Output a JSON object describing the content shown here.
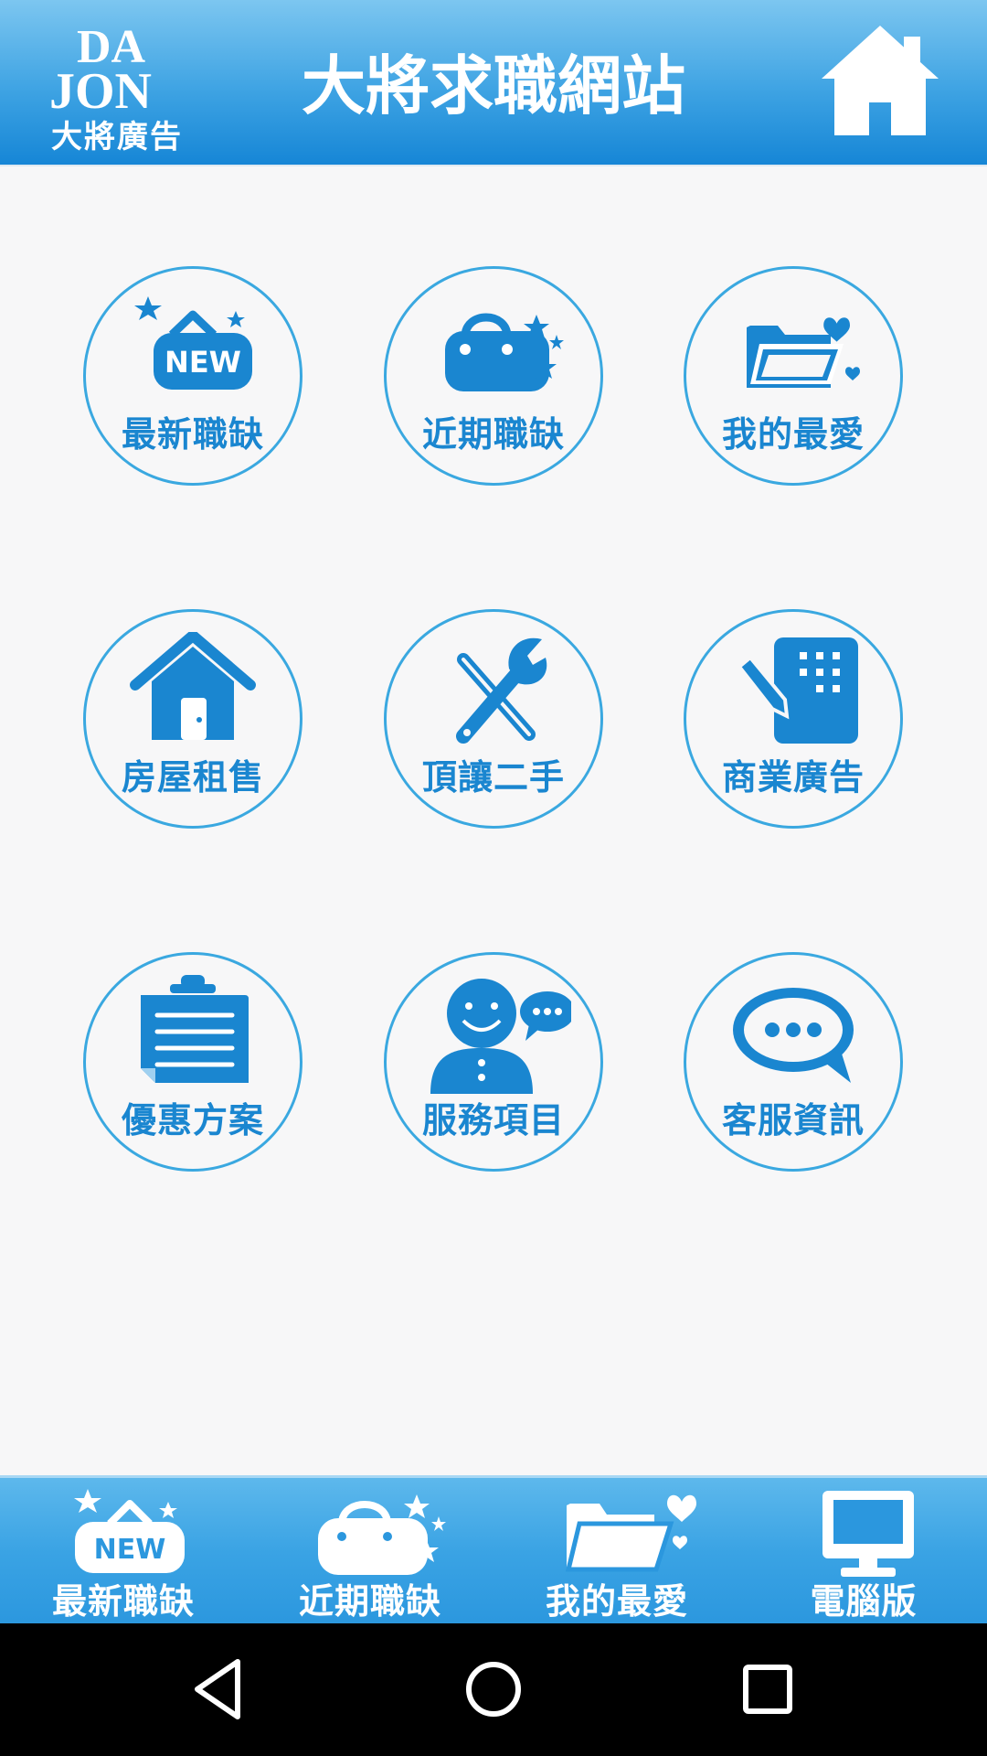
{
  "header": {
    "logo_text": "大將廣告",
    "logo_mark_top": "DA",
    "logo_mark_bottom": "JON",
    "title": "大將求職網站",
    "home_icon": "home-icon"
  },
  "menu": {
    "items": [
      {
        "label": "最新職缺",
        "icon": "new-sign-icon"
      },
      {
        "label": "近期職缺",
        "icon": "bag-icon"
      },
      {
        "label": "我的最愛",
        "icon": "folder-heart-icon"
      },
      {
        "label": "房屋租售",
        "icon": "house-icon"
      },
      {
        "label": "頂讓二手",
        "icon": "tools-icon"
      },
      {
        "label": "商業廣告",
        "icon": "building-pen-icon"
      },
      {
        "label": "優惠方案",
        "icon": "clipboard-icon"
      },
      {
        "label": "服務項目",
        "icon": "service-person-icon"
      },
      {
        "label": "客服資訊",
        "icon": "chat-bubble-icon"
      }
    ],
    "new_badge": "NEW"
  },
  "tabbar": {
    "items": [
      {
        "label": "最新職缺",
        "icon": "new-sign-icon"
      },
      {
        "label": "近期職缺",
        "icon": "bag-icon"
      },
      {
        "label": "我的最愛",
        "icon": "folder-heart-icon"
      },
      {
        "label": "電腦版",
        "icon": "monitor-icon"
      }
    ],
    "new_badge": "NEW"
  },
  "colors": {
    "accent": "#1a86d0",
    "tile_border": "#3aa8e0",
    "header_top": "#7cc6f0",
    "header_bottom": "#1686d6",
    "background": "#f7f7f8"
  },
  "system_nav": {
    "back_icon": "back-triangle-icon",
    "home_icon": "home-circle-icon",
    "recents_icon": "recents-square-icon"
  }
}
